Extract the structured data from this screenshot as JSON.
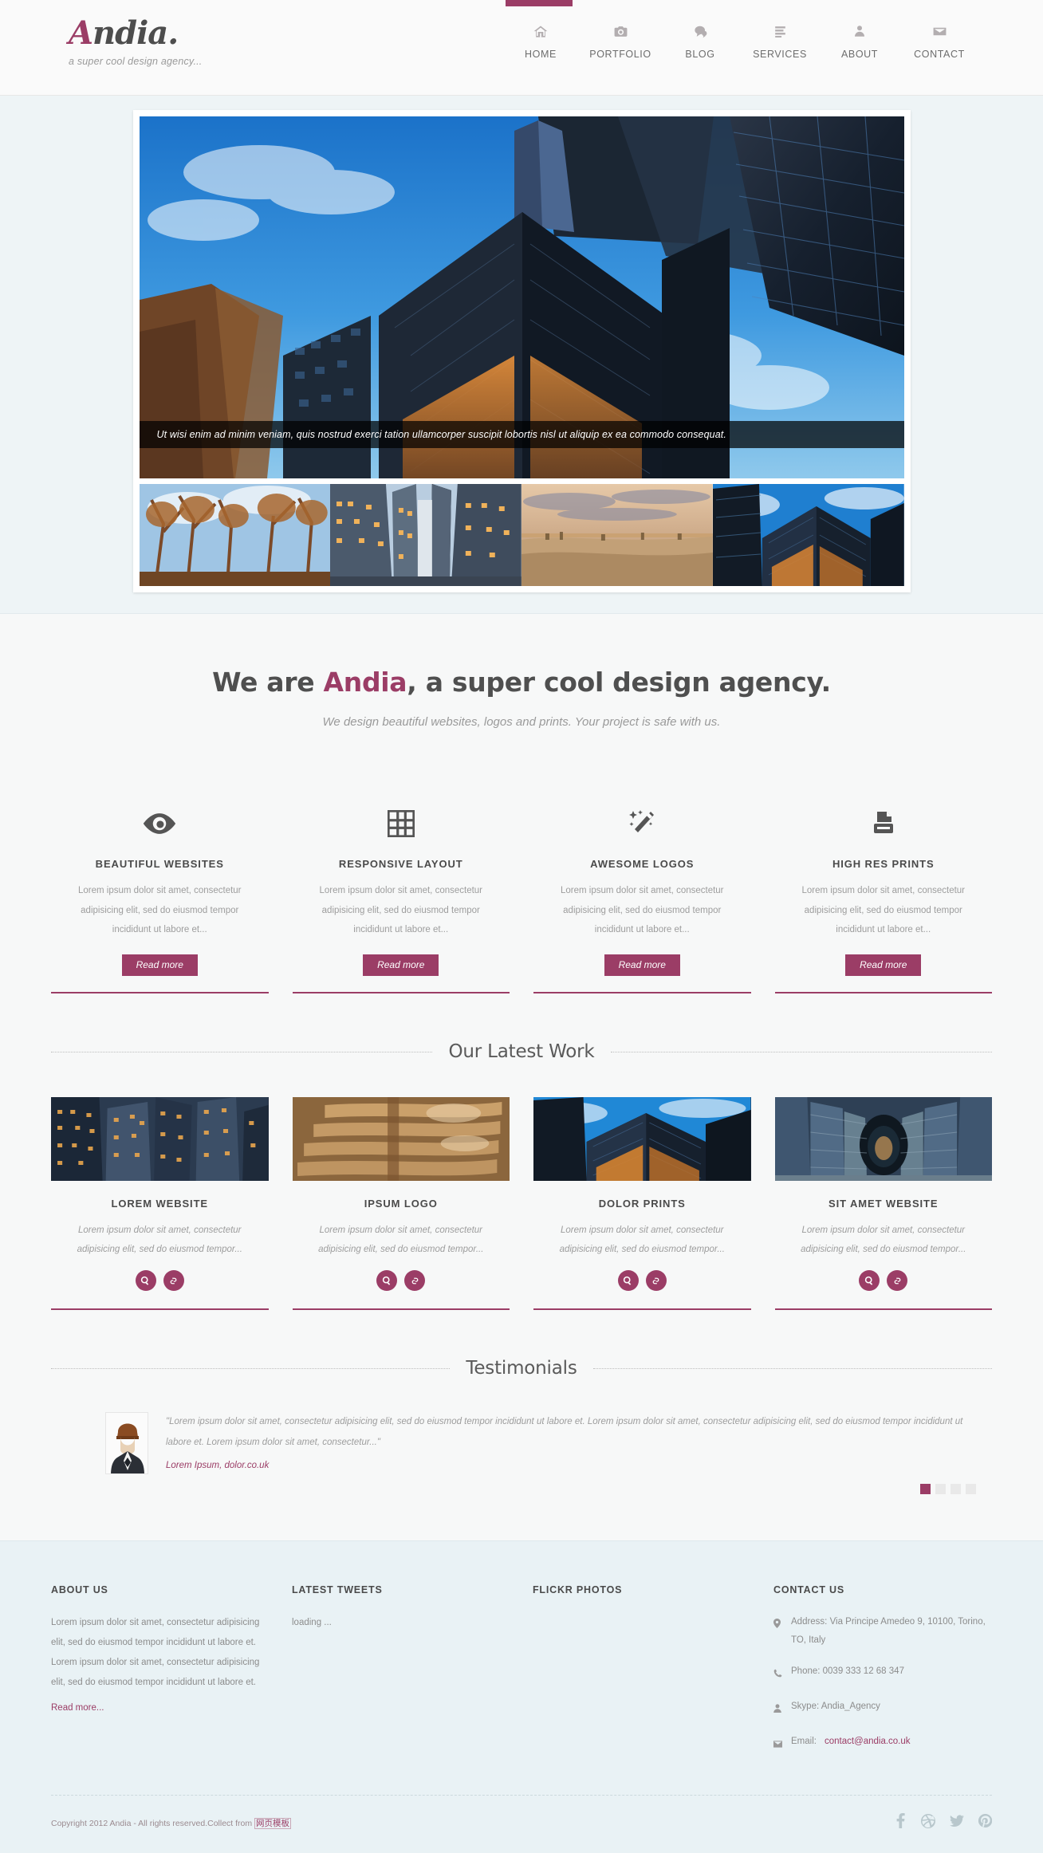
{
  "header": {
    "logo_main": "ndia.",
    "logo_accent": "A",
    "tagline": "a super cool design agency...",
    "nav": [
      {
        "label": "HOME",
        "icon": "home-icon",
        "active": true
      },
      {
        "label": "PORTFOLIO",
        "icon": "camera-icon",
        "active": false
      },
      {
        "label": "BLOG",
        "icon": "comment-icon",
        "active": false
      },
      {
        "label": "SERVICES",
        "icon": "list-icon",
        "active": false
      },
      {
        "label": "ABOUT",
        "icon": "user-icon",
        "active": false
      },
      {
        "label": "CONTACT",
        "icon": "envelope-icon",
        "active": false
      }
    ]
  },
  "slider": {
    "caption": "Ut wisi enim ad minim veniam, quis nostrud exerci tation ullamcorper suscipit lobortis nisl ut aliquip ex ea commodo consequat.",
    "thumbs": [
      "thumb-autumn-trees",
      "thumb-city-street",
      "thumb-desert-sunset",
      "thumb-glass-tower"
    ]
  },
  "intro": {
    "title_pre": "We are ",
    "title_accent": "Andia",
    "title_post": ", a super cool design agency.",
    "subtitle": "We design beautiful websites, logos and prints. Your project is safe with us."
  },
  "services": {
    "items": [
      {
        "icon": "eye-icon",
        "title": "BEAUTIFUL WEBSITES",
        "text": "Lorem ipsum dolor sit amet, consectetur adipisicing elit, sed do eiusmod tempor incididunt ut labore et...",
        "button": "Read more"
      },
      {
        "icon": "grid-icon",
        "title": "RESPONSIVE LAYOUT",
        "text": "Lorem ipsum dolor sit amet, consectetur adipisicing elit, sed do eiusmod tempor incididunt ut labore et...",
        "button": "Read more"
      },
      {
        "icon": "wand-icon",
        "title": "AWESOME LOGOS",
        "text": "Lorem ipsum dolor sit amet, consectetur adipisicing elit, sed do eiusmod tempor incididunt ut labore et...",
        "button": "Read more"
      },
      {
        "icon": "printer-icon",
        "title": "HIGH RES PRINTS",
        "text": "Lorem ipsum dolor sit amet, consectetur adipisicing elit, sed do eiusmod tempor incididunt ut labore et...",
        "button": "Read more"
      }
    ]
  },
  "latest_work": {
    "heading": "Our Latest Work",
    "items": [
      {
        "title": "LOREM WEBSITE",
        "text": "Lorem ipsum dolor sit amet, consectetur adipisicing elit, sed do eiusmod tempor...",
        "zoom_icon": "search-icon",
        "link_icon": "link-icon"
      },
      {
        "title": "IPSUM LOGO",
        "text": "Lorem ipsum dolor sit amet, consectetur adipisicing elit, sed do eiusmod tempor...",
        "zoom_icon": "search-icon",
        "link_icon": "link-icon"
      },
      {
        "title": "DOLOR PRINTS",
        "text": "Lorem ipsum dolor sit amet, consectetur adipisicing elit, sed do eiusmod tempor...",
        "zoom_icon": "search-icon",
        "link_icon": "link-icon"
      },
      {
        "title": "SIT AMET WEBSITE",
        "text": "Lorem ipsum dolor sit amet, consectetur adipisicing elit, sed do eiusmod tempor...",
        "zoom_icon": "search-icon",
        "link_icon": "link-icon"
      }
    ]
  },
  "testimonials": {
    "heading": "Testimonials",
    "quote": "\"Lorem ipsum dolor sit amet, consectetur adipisicing elit, sed do eiusmod tempor incididunt ut labore et. Lorem ipsum dolor sit amet, consectetur adipisicing elit, sed do eiusmod tempor incididunt ut labore et. Lorem ipsum dolor sit amet, consectetur...\"",
    "author": "Lorem Ipsum, dolor.co.uk",
    "dots": 4,
    "active_dot": 1
  },
  "footer": {
    "about": {
      "heading": "ABOUT US",
      "text": "Lorem ipsum dolor sit amet, consectetur adipisicing elit, sed do eiusmod tempor incididunt ut labore et. Lorem ipsum dolor sit amet, consectetur adipisicing elit, sed do eiusmod tempor incididunt ut labore et.",
      "link": "Read more..."
    },
    "tweets": {
      "heading": "LATEST TWEETS",
      "status": "loading ..."
    },
    "flickr": {
      "heading": "FLICKR PHOTOS"
    },
    "contact": {
      "heading": "CONTACT US",
      "address_label": "Address: Via Principe Amedeo 9, 10100, Torino, TO, Italy",
      "phone_label": "Phone: 0039 333 12 68 347",
      "skype_label": "Skype: Andia_Agency",
      "email_label": "Email:",
      "email_value": "contact@andia.co.uk"
    },
    "copyright_pre": "Copyright 2012 Andia - All rights reserved.Collect from ",
    "copyright_cn": "网页模板",
    "socials": [
      "facebook-icon",
      "dribbble-icon",
      "twitter-icon",
      "pinterest-icon"
    ]
  },
  "colors": {
    "accent": "#9b3d66",
    "text_dark": "#4a4a4a",
    "text_muted": "#9d9d9d",
    "footer_bg": "#e9f2f5",
    "slider_bg": "#eef4f6"
  }
}
